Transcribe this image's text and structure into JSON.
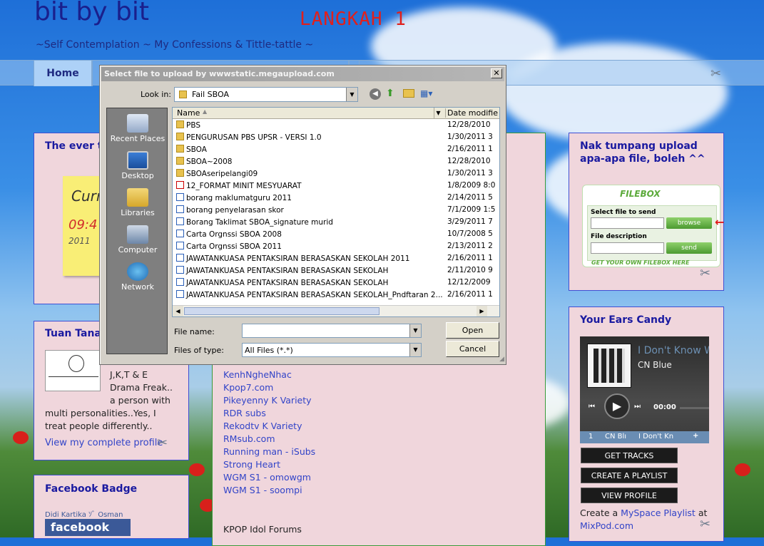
{
  "header": {
    "title": "bit by bit",
    "subtitle": "~Self Contemplation ~ My Confessions & Tittle-tattle ~",
    "annotation": "LANGKAH 1"
  },
  "nav": {
    "home": "Home"
  },
  "left": {
    "ever_title": "The ever tic",
    "sticky_text": "Curr",
    "sticky_time": "09:4",
    "sticky_year": "2011",
    "tuan_title": "Tuan Tanah",
    "tuan_lines": [
      "J,K,T & E",
      "Drama Freak..",
      "a person with",
      "multi personalities..Yes, I",
      "treat people differently.."
    ],
    "profile_link": "View my complete profile",
    "fb_title": "Facebook Badge",
    "fb_name": "Didi Kartika ｿﾞ Osman",
    "fb_logo": "facebook"
  },
  "middle": {
    "links": [
      "KenhNgheNhac",
      "Kpop7.com",
      "Pikeyenny K Variety",
      "RDR subs",
      "Rekodtv K Variety",
      "RMsub.com",
      "Running man - iSubs",
      "Strong Heart",
      "WGM S1 - omowgm",
      "WGM S1 - soompi"
    ],
    "forums": "KPOP Idol Forums"
  },
  "right": {
    "upload_title": "Nak tumpang upload apa-apa file, boleh ^^",
    "filebox": {
      "brand": "FILEBOX",
      "select": "Select file to send",
      "browse": "browse",
      "desc": "File description",
      "send": "send",
      "footer": "GET YOUR OWN FILEBOX HERE"
    },
    "ears_title": "Your Ears Candy",
    "player": {
      "song": "I Don't Know W",
      "artist": "CN Blue",
      "time": "00:00",
      "tab1": "CN Blı",
      "tab2": "I Don't Kn"
    },
    "buttons": [
      "GET TRACKS",
      "CREATE A PLAYLIST",
      "VIEW PROFILE"
    ],
    "create_pre": "Create a ",
    "create_link": "MySpace Playlist",
    "create_post": " at",
    "mixpod": "MixPod.com"
  },
  "dialog": {
    "title": "Select file to upload by wwwstatic.megaupload.com",
    "look_in_label": "Look in:",
    "look_in_value": "Fail SBOA",
    "columns": {
      "name": "Name",
      "date": "Date modifie"
    },
    "places": [
      "Recent Places",
      "Desktop",
      "Libraries",
      "Computer",
      "Network"
    ],
    "files": [
      {
        "name": "PBS",
        "date": "12/28/2010",
        "type": "folder"
      },
      {
        "name": "PENGURUSAN PBS UPSR - VERSI 1.0",
        "date": "1/30/2011 3",
        "type": "folder"
      },
      {
        "name": "SBOA",
        "date": "2/16/2011 1",
        "type": "folder"
      },
      {
        "name": "SBOA~2008",
        "date": "12/28/2010",
        "type": "folder"
      },
      {
        "name": "SBOAseripelangi09",
        "date": "1/30/2011 3",
        "type": "folder"
      },
      {
        "name": "12_FORMAT MINIT MESYUARAT",
        "date": "1/8/2009 8:0",
        "type": "pdf"
      },
      {
        "name": "borang maklumatguru 2011",
        "date": "2/14/2011 5",
        "type": "doc"
      },
      {
        "name": "borang penyelarasan skor",
        "date": "7/1/2009 1:5",
        "type": "doc"
      },
      {
        "name": "Borang Taklimat SBOA_signature murid",
        "date": "3/29/2011 7",
        "type": "doc"
      },
      {
        "name": "Carta Orgnssi SBOA 2008",
        "date": "10/7/2008 5",
        "type": "doc"
      },
      {
        "name": "Carta Orgnssi SBOA 2011",
        "date": "2/13/2011 2",
        "type": "doc"
      },
      {
        "name": "JAWATANKUASA PENTAKSIRAN BERASASKAN SEKOLAH 2011",
        "date": "2/16/2011 1",
        "type": "doc"
      },
      {
        "name": "JAWATANKUASA PENTAKSIRAN BERASASKAN SEKOLAH",
        "date": "2/11/2010 9",
        "type": "doc"
      },
      {
        "name": "JAWATANKUASA PENTAKSIRAN BERASASKAN SEKOLAH",
        "date": "12/12/2009",
        "type": "doc"
      },
      {
        "name": "JAWATANKUASA PENTAKSIRAN BERASASKAN SEKOLAH_Pndftaran 2...",
        "date": "2/16/2011 1",
        "type": "doc"
      }
    ],
    "file_name_label": "File name:",
    "file_name_value": "",
    "file_type_label": "Files of type:",
    "file_type_value": "All Files (*.*)",
    "open": "Open",
    "cancel": "Cancel"
  }
}
